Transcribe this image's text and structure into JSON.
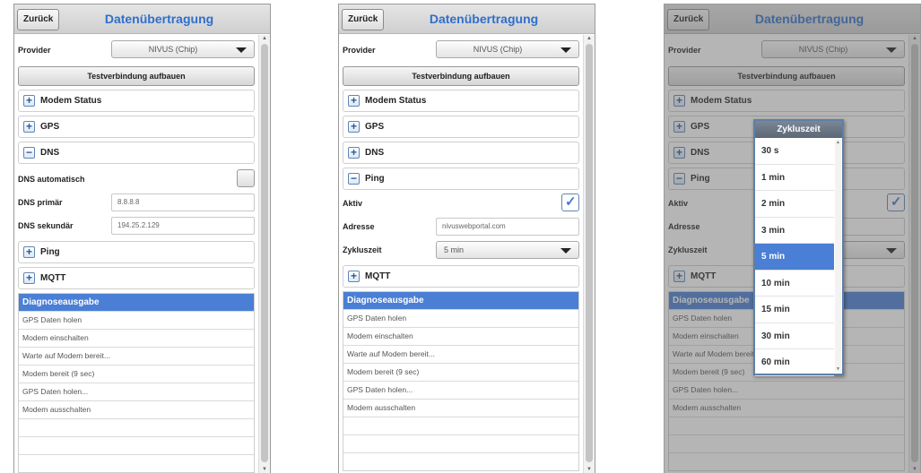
{
  "header": {
    "back_label": "Zurück",
    "title": "Datenübertragung"
  },
  "provider": {
    "label": "Provider",
    "value": "NIVUS (Chip)"
  },
  "test_button": "Testverbindung aufbauen",
  "sections": {
    "modem_status": "Modem Status",
    "gps": "GPS",
    "dns": "DNS",
    "ping": "Ping",
    "mqtt": "MQTT"
  },
  "icons": {
    "expand": "+",
    "collapse": "−",
    "check": "✓",
    "scroll_up": "▲",
    "scroll_down": "▼"
  },
  "dns_fields": {
    "auto_label": "DNS automatisch",
    "primary_label": "DNS primär",
    "primary_value": "8.8.8.8",
    "secondary_label": "DNS sekundär",
    "secondary_value": "194.25.2.129"
  },
  "ping_fields": {
    "active_label": "Aktiv",
    "address_label": "Adresse",
    "address_value": "nivuswebportal.com",
    "cycle_label": "Zykluszeit",
    "cycle_value": "5 min"
  },
  "diagnostics": {
    "header": "Diagnoseausgabe",
    "rows": [
      "GPS Daten holen",
      "Modem einschalten",
      "Warte auf Modem bereit...",
      "Modem bereit (9 sec)",
      "GPS Daten holen...",
      "Modem ausschalten",
      "",
      "",
      "",
      ""
    ]
  },
  "cycle_popup": {
    "title": "Zykluszeit",
    "options": [
      "30 s",
      "1 min",
      "2 min",
      "3 min",
      "5 min",
      "10 min",
      "15 min",
      "30 min",
      "60 min"
    ],
    "selected": "5 min"
  },
  "colors": {
    "accent": "#2f6fcc",
    "selection": "#4a7fd5",
    "dim_overlay": "#5a5a5a"
  }
}
